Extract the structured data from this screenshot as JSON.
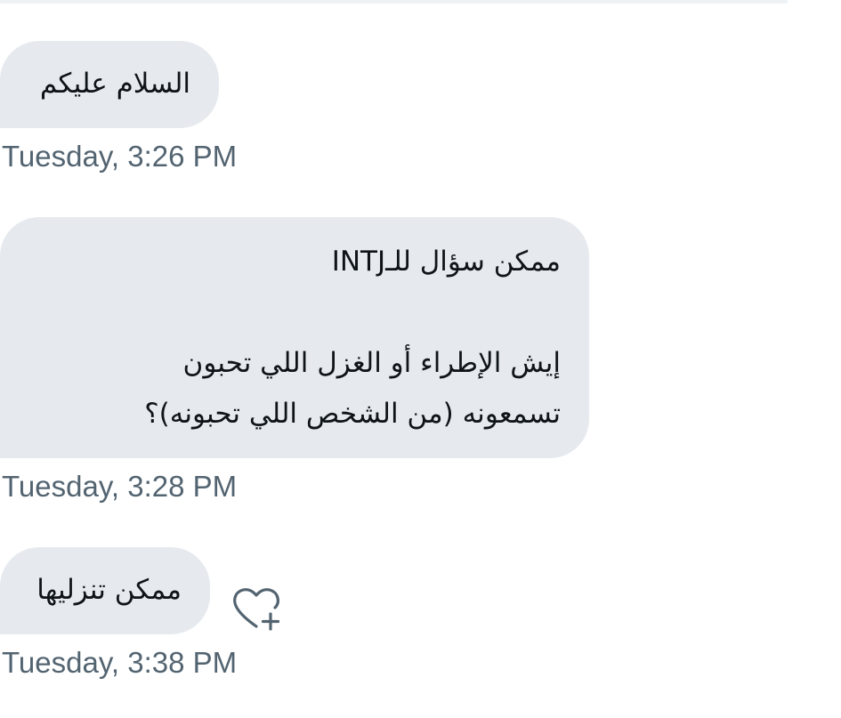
{
  "messages": [
    {
      "lines": [
        "السلام عليكم"
      ],
      "timestamp": "Tuesday, 3:26 PM"
    },
    {
      "lines": [
        "ممكن سؤال للـINTJ",
        "",
        "إيش الإطراء أو الغزل اللي تحبون",
        "تسمعونه (من الشخص اللي تحبونه)؟"
      ],
      "timestamp": "Tuesday, 3:28 PM"
    },
    {
      "lines": [
        "ممكن تنزليها"
      ],
      "timestamp": "Tuesday, 3:38 PM",
      "reaction_icon": "add-reaction-heart-icon"
    }
  ],
  "colors": {
    "bubble_bg": "#e6eaee",
    "text": "#0f1419",
    "timestamp": "#536471",
    "icon": "#536471"
  }
}
